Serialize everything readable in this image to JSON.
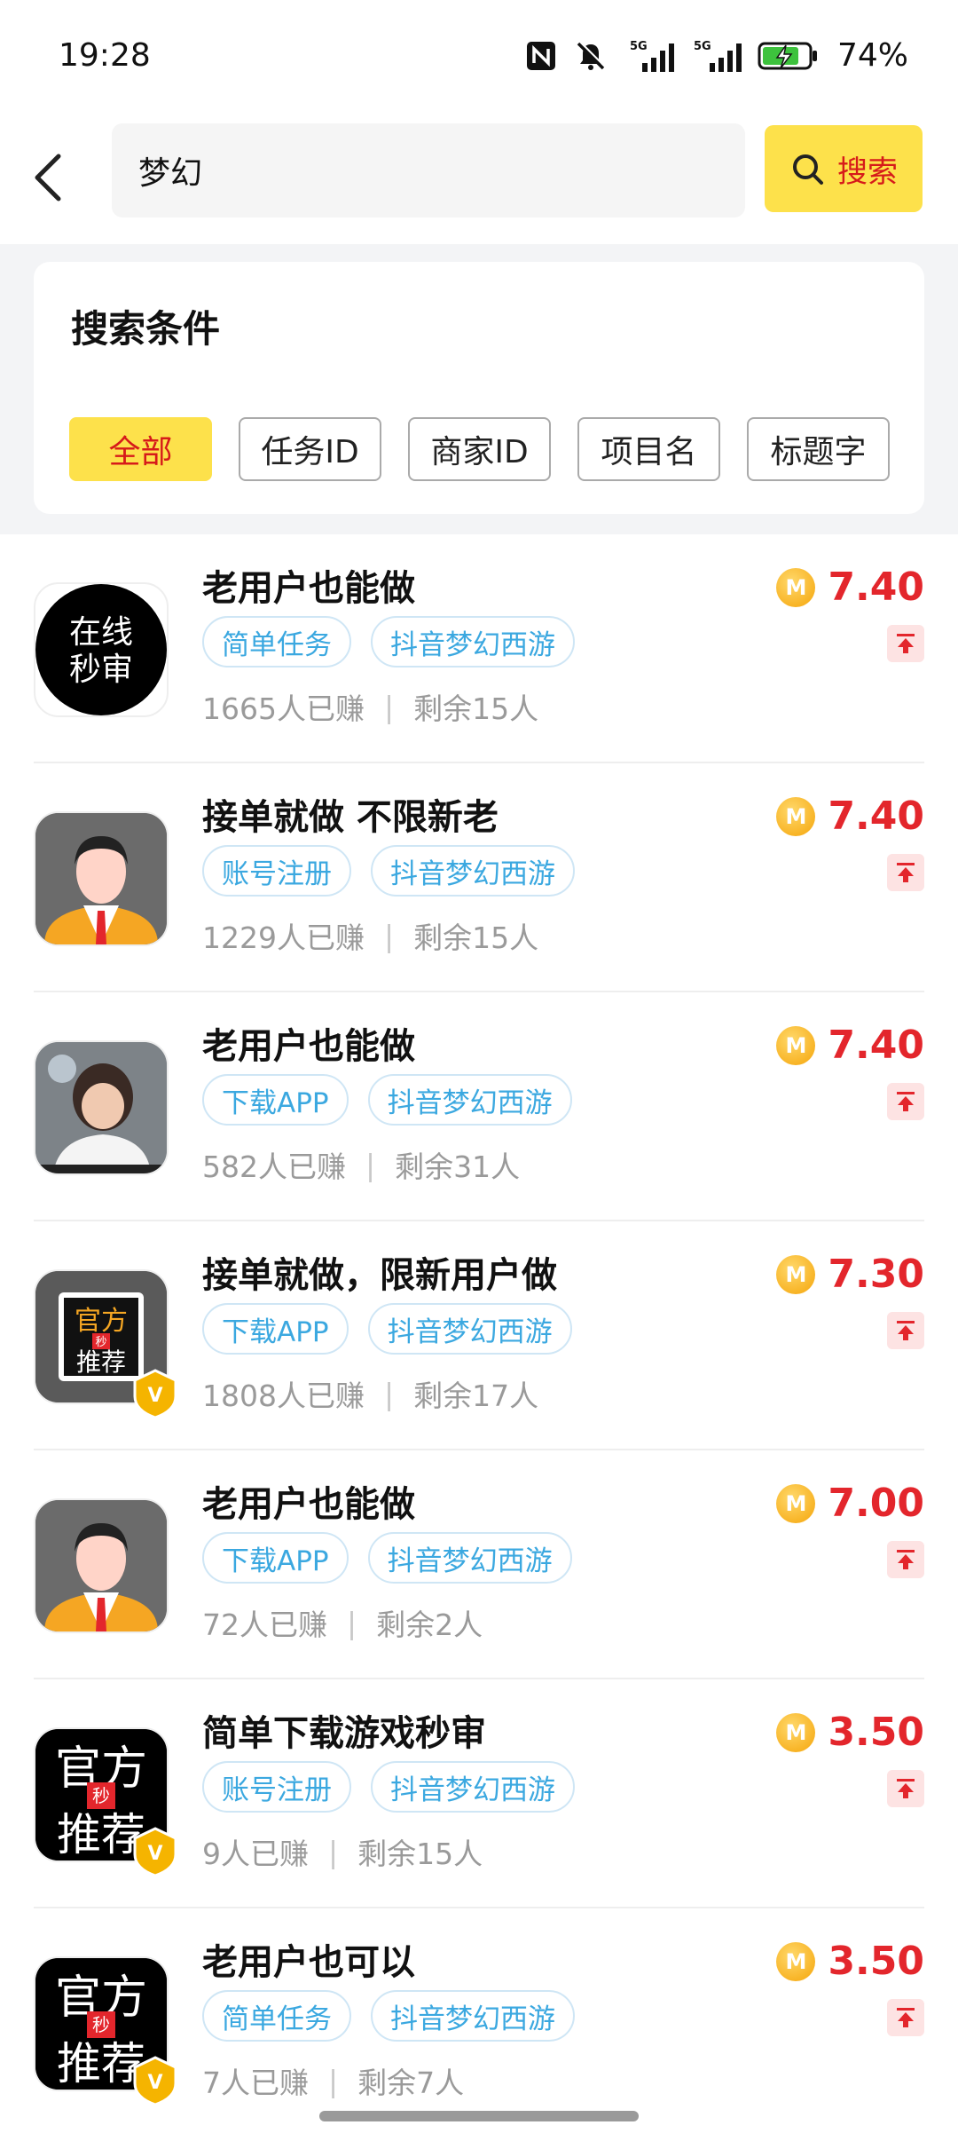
{
  "status_bar": {
    "time": "19:28",
    "battery": "74%",
    "network_1": "5G",
    "network_2": "5G"
  },
  "search": {
    "query": "梦幻",
    "button_label": "搜索"
  },
  "conditions": {
    "title": "搜索条件",
    "filters": [
      "全部",
      "任务ID",
      "商家ID",
      "项目名",
      "标题字"
    ],
    "active_filter": "全部"
  },
  "tasks": [
    {
      "title": "老用户也能做",
      "tags": [
        "简单任务",
        "抖音梦幻西游"
      ],
      "earned": "1665人已赚",
      "remaining": "剩余15人",
      "price": "7.40",
      "coin": "M",
      "avatar": "online-review-logo",
      "avatar_text": [
        "在线",
        "秒审"
      ],
      "verified": false
    },
    {
      "title": "接单就做 不限新老",
      "tags": [
        "账号注册",
        "抖音梦幻西游"
      ],
      "earned": "1229人已赚",
      "remaining": "剩余15人",
      "price": "7.40",
      "coin": "M",
      "avatar": "default-user-avatar",
      "verified": false
    },
    {
      "title": "老用户也能做",
      "tags": [
        "下载APP",
        "抖音梦幻西游"
      ],
      "earned": "582人已赚",
      "remaining": "剩余31人",
      "price": "7.40",
      "coin": "M",
      "avatar": "child-photo-avatar",
      "verified": false
    },
    {
      "title": "接单就做，限新用户做",
      "tags": [
        "下载APP",
        "抖音梦幻西游"
      ],
      "earned": "1808人已赚",
      "remaining": "剩余17人",
      "price": "7.30",
      "coin": "M",
      "avatar": "official-recommend-logo-small",
      "avatar_text": [
        "官方",
        "秒",
        "推荐"
      ],
      "verified": true
    },
    {
      "title": "老用户也能做",
      "tags": [
        "下载APP",
        "抖音梦幻西游"
      ],
      "earned": "72人已赚",
      "remaining": "剩余2人",
      "price": "7.00",
      "coin": "M",
      "avatar": "default-user-avatar",
      "verified": false
    },
    {
      "title": "简单下载游戏秒审",
      "tags": [
        "账号注册",
        "抖音梦幻西游"
      ],
      "earned": "9人已赚",
      "remaining": "剩余15人",
      "price": "3.50",
      "coin": "M",
      "avatar": "official-recommend-logo",
      "avatar_text": [
        "官方",
        "秒",
        "推荐"
      ],
      "verified": true
    },
    {
      "title": "老用户也可以",
      "tags": [
        "简单任务",
        "抖音梦幻西游"
      ],
      "earned": "7人已赚",
      "remaining": "剩余7人",
      "price": "3.50",
      "coin": "M",
      "avatar": "official-recommend-logo",
      "avatar_text": [
        "官方",
        "秒",
        "推荐"
      ],
      "verified": true
    }
  ],
  "colors": {
    "accent_yellow": "#fde14b",
    "price_red": "#e3262c",
    "tag_blue": "#3ba8e0"
  }
}
